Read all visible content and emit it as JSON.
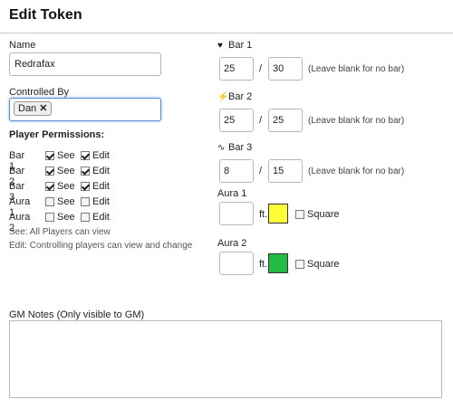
{
  "dialog": {
    "title": "Edit Token"
  },
  "name": {
    "label": "Name",
    "value": "Redrafax"
  },
  "controlled_by": {
    "label": "Controlled By",
    "tag": "Dan",
    "remove_glyph": "✕"
  },
  "permissions": {
    "title": "Player Permissions:",
    "see_label": "See",
    "edit_label": "Edit",
    "rows": [
      {
        "name": "Bar 1",
        "see": true,
        "edit": true
      },
      {
        "name": "Bar 2",
        "see": true,
        "edit": true
      },
      {
        "name": "Bar 3",
        "see": true,
        "edit": true
      },
      {
        "name": "Aura 1",
        "see": false,
        "edit": false
      },
      {
        "name": "Aura 2",
        "see": false,
        "edit": false
      }
    ],
    "help_see": "See: All Players can view",
    "help_edit": "Edit: Controlling players can view and change"
  },
  "bars": [
    {
      "label": "Bar 1",
      "icon": "heart-icon",
      "glyph": "♥",
      "value": "25",
      "max": "30",
      "hint": "(Leave blank for no bar)"
    },
    {
      "label": "Bar 2",
      "icon": "lightning-icon",
      "glyph": "⚡",
      "value": "25",
      "max": "25",
      "hint": "(Leave blank for no bar)"
    },
    {
      "label": "Bar 3",
      "icon": "pulse-icon",
      "glyph": "∿",
      "value": "8",
      "max": "15",
      "hint": "(Leave blank for no bar)"
    }
  ],
  "slash": "/",
  "auras": [
    {
      "label": "Aura 1",
      "value": "",
      "unit": "ft.",
      "color": "#ffff33",
      "square_label": "Square",
      "square": false
    },
    {
      "label": "Aura 2",
      "value": "",
      "unit": "ft.",
      "color": "#22bb44",
      "square_label": "Square",
      "square": false
    }
  ],
  "gm_notes": {
    "label": "GM Notes (Only visible to GM)",
    "value": ""
  }
}
